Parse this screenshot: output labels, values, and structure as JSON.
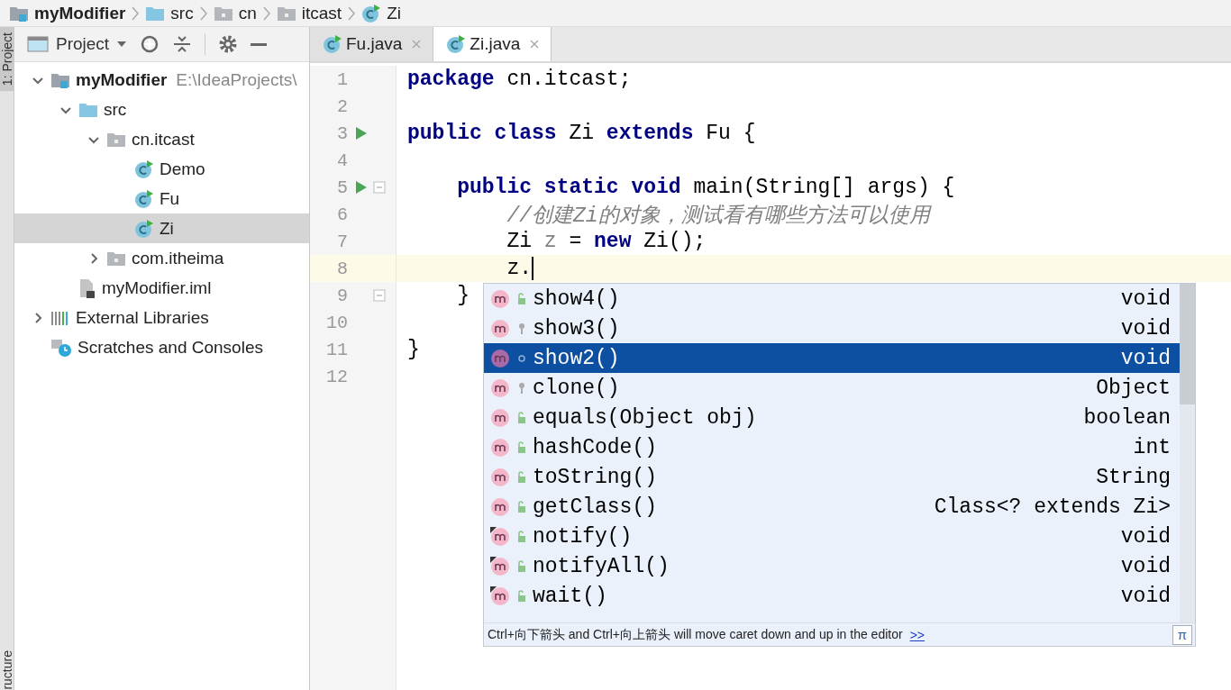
{
  "breadcrumb": [
    {
      "label": "myModifier",
      "kind": "module"
    },
    {
      "label": "src",
      "kind": "folder"
    },
    {
      "label": "cn",
      "kind": "package"
    },
    {
      "label": "itcast",
      "kind": "package"
    },
    {
      "label": "Zi",
      "kind": "class"
    }
  ],
  "side_strip": {
    "top_tab": "1: Project",
    "bottom_tab": "ructure"
  },
  "project_panel": {
    "title": "Project",
    "tree": [
      {
        "label": "myModifier",
        "path": "E:\\IdeaProjects\\",
        "kind": "module",
        "expanded": true,
        "selected": false,
        "children": [
          {
            "label": "src",
            "kind": "folder",
            "expanded": true,
            "selected": false,
            "children": [
              {
                "label": "cn.itcast",
                "kind": "package",
                "expanded": true,
                "selected": false,
                "children": [
                  {
                    "label": "Demo",
                    "kind": "class",
                    "selected": false
                  },
                  {
                    "label": "Fu",
                    "kind": "class",
                    "selected": false
                  },
                  {
                    "label": "Zi",
                    "kind": "class",
                    "selected": true
                  }
                ]
              },
              {
                "label": "com.itheima",
                "kind": "package",
                "expanded": false,
                "selected": false
              }
            ]
          },
          {
            "label": "myModifier.iml",
            "kind": "file",
            "selected": false
          }
        ]
      },
      {
        "label": "External Libraries",
        "kind": "libraries",
        "expanded": false,
        "selected": false
      },
      {
        "label": "Scratches and Consoles",
        "kind": "scratches",
        "selected": false
      }
    ]
  },
  "tabs": [
    {
      "label": "Fu.java",
      "selected": false
    },
    {
      "label": "Zi.java",
      "selected": true
    }
  ],
  "editor": {
    "lines": [
      {
        "number": "1",
        "run": false,
        "fold": false,
        "current": false,
        "code": [
          {
            "text": "package",
            "kind": "keyword"
          },
          {
            "text": " cn.itcast;",
            "kind": "plain"
          }
        ]
      },
      {
        "number": "2",
        "run": false,
        "fold": false,
        "current": false
      },
      {
        "number": "3",
        "run": true,
        "fold": false,
        "current": false,
        "code": [
          {
            "text": "public class",
            "kind": "keyword"
          },
          {
            "text": " Zi ",
            "kind": "plain"
          },
          {
            "text": "extends",
            "kind": "keyword"
          },
          {
            "text": " Fu {",
            "kind": "plain"
          }
        ]
      },
      {
        "number": "4",
        "run": false,
        "fold": false,
        "current": false
      },
      {
        "number": "5",
        "run": true,
        "fold": true,
        "current": false,
        "code": [
          {
            "text": "    public static void",
            "kind": "keyword"
          },
          {
            "text": " main(String[] args) {",
            "kind": "plain"
          }
        ]
      },
      {
        "number": "6",
        "run": false,
        "fold": false,
        "current": false,
        "code": [
          {
            "text": "        //创建Zi的对象，测试看有哪些方法可以使用",
            "kind": "comment"
          }
        ]
      },
      {
        "number": "7",
        "run": false,
        "fold": false,
        "current": false,
        "code": [
          {
            "text": "        Zi ",
            "kind": "plain"
          },
          {
            "text": "z",
            "kind": "unused"
          },
          {
            "text": " = ",
            "kind": "plain"
          },
          {
            "text": "new",
            "kind": "keyword"
          },
          {
            "text": " Zi();",
            "kind": "plain"
          }
        ]
      },
      {
        "number": "8",
        "run": false,
        "fold": false,
        "current": true,
        "code": [
          {
            "text": "        z.",
            "kind": "plain"
          }
        ]
      },
      {
        "number": "9",
        "run": false,
        "fold": true,
        "current": false,
        "code": [
          {
            "text": "    }",
            "kind": "plain"
          }
        ]
      },
      {
        "number": "10",
        "run": false,
        "fold": false,
        "current": false
      },
      {
        "number": "11",
        "run": false,
        "fold": false,
        "current": false,
        "code": [
          {
            "text": "}",
            "kind": "plain"
          }
        ]
      },
      {
        "number": "12",
        "run": false,
        "fold": false,
        "current": false
      }
    ]
  },
  "completion": {
    "items": [
      {
        "name": "show4()",
        "type": "void",
        "kind": "public",
        "final": false,
        "selected": false
      },
      {
        "name": "show3()",
        "type": "void",
        "kind": "protected",
        "final": false,
        "selected": false
      },
      {
        "name": "show2()",
        "type": "void",
        "kind": "package",
        "final": false,
        "selected": true
      },
      {
        "name": "clone()",
        "type": "Object",
        "kind": "protected",
        "final": false,
        "selected": false
      },
      {
        "name": "equals(Object obj)",
        "type": "boolean",
        "kind": "public",
        "final": false,
        "selected": false
      },
      {
        "name": "hashCode()",
        "type": "int",
        "kind": "public",
        "final": false,
        "selected": false
      },
      {
        "name": "toString()",
        "type": "String",
        "kind": "public",
        "final": false,
        "selected": false
      },
      {
        "name": "getClass()",
        "type": "Class<? extends Zi>",
        "kind": "public",
        "final": false,
        "selected": false
      },
      {
        "name": "notify()",
        "type": "void",
        "kind": "public",
        "final": true,
        "selected": false
      },
      {
        "name": "notifyAll()",
        "type": "void",
        "kind": "public",
        "final": true,
        "selected": false
      },
      {
        "name": "wait()",
        "type": "void",
        "kind": "public",
        "final": true,
        "selected": false
      }
    ],
    "hint": "Ctrl+向下箭头 and Ctrl+向上箭头 will move caret down and up in the editor",
    "hint_link": ">>",
    "pi_button": "π"
  }
}
